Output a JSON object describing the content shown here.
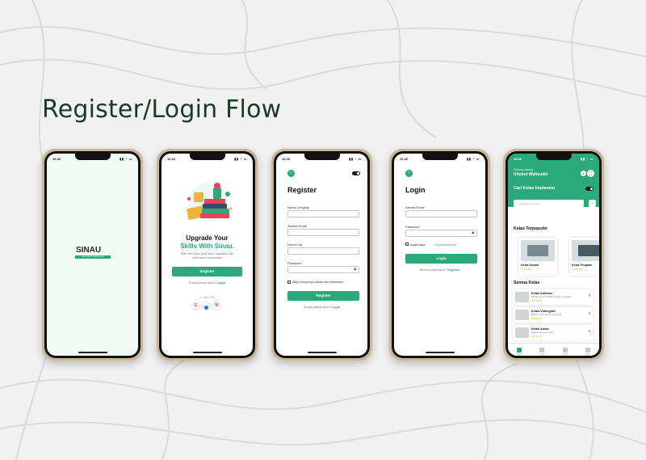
{
  "page_title": "Register/Login Flow",
  "colors": {
    "primary": "#2aa97a",
    "background": "#f1f1f1",
    "frame": "#c9b597",
    "title": "#173a2b"
  },
  "status_time": "10.26",
  "splash": {
    "logo_text": "SINAU",
    "tagline": "Lorem ipsum dolor sit amet"
  },
  "welcome": {
    "headline_line1": "Upgrade Your",
    "headline_line2": "Skills With Sinau.",
    "description": "Raih ilmu baru, pasti kamu dapatkan dan pasti kamu bermanfaat",
    "register_button": "Register",
    "login_prompt": "Sudah punya akun?",
    "login_link": "Login",
    "divider_text": "or Login With",
    "social_icons": [
      "google-icon",
      "facebook-icon",
      "office-icon"
    ]
  },
  "register": {
    "title": "Register",
    "labels": [
      "Nama Lengkap",
      "Alamat Email",
      "Nomor Hp",
      "Password"
    ],
    "agree_text": "Saya menyetujui privasi dan keamanan",
    "submit_button": "Register",
    "login_prompt": "Sudah punya akun?",
    "login_link": "Login"
  },
  "login": {
    "title": "Login",
    "labels": [
      "Alamat Email",
      "Password"
    ],
    "remember_text": "Ingat saya",
    "forgot_link": "Lupa password",
    "submit_button": "Login",
    "register_prompt": "Belum punya akun?",
    "register_link": "Register"
  },
  "dashboard": {
    "greeting": "Selamat datang",
    "user_name": "Khoirul Wahyudin",
    "banner_text": "Cari Kelas Impianmu",
    "search_placeholder": "Cari kelas impianmu",
    "popular_title": "Kelas Terpopuler",
    "popular": [
      {
        "name": "Kelas Desain",
        "stars": "★★★★★"
      },
      {
        "name": "Kelas Program",
        "stars": "★★★★★"
      }
    ],
    "all_title": "Semua Kelas",
    "classes": [
      {
        "name": "Kelas Animasi",
        "desc": "Belajar animasi 2D&3D dengan mengasah",
        "stars": "★★★★★"
      },
      {
        "name": "Kelas Videografi",
        "desc": "Belajar teknik video & videografi",
        "stars": "★★★★★"
      },
      {
        "name": "Kelas Audio",
        "desc": "Belajar mengolah audio",
        "stars": "★★★★★"
      }
    ],
    "nav": [
      "Home",
      "Kelas",
      "Favorit",
      "Akun"
    ]
  }
}
